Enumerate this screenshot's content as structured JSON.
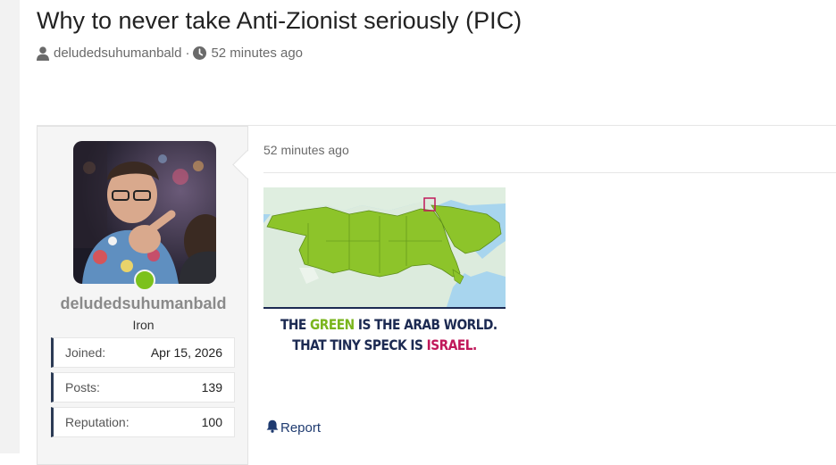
{
  "thread": {
    "title": "Why to never take Anti-Zionist seriously (PIC)",
    "author": "deludedsuhumanbald",
    "separator": "·",
    "time": "52 minutes ago"
  },
  "author_card": {
    "username": "deludedsuhumanbald",
    "rank": "Iron",
    "online_status_color": "#7cc11c",
    "stats": [
      {
        "label": "Joined:",
        "value": "Apr 15, 2026"
      },
      {
        "label": "Posts:",
        "value": "139"
      },
      {
        "label": "Reputation:",
        "value": "100"
      }
    ]
  },
  "post": {
    "time": "52 minutes ago",
    "image_caption": {
      "line1_a": "THE ",
      "line1_green": "GREEN",
      "line1_b": " IS THE ARAB WORLD.",
      "line2_a": "THAT TINY SPECK IS ",
      "line2_red": "ISRAEL."
    },
    "report_label": "Report"
  },
  "colors": {
    "accent_navy": "#1c2a52",
    "highlight_green": "#7ab51d",
    "highlight_red": "#c0185a",
    "link": "#1f3b70"
  }
}
